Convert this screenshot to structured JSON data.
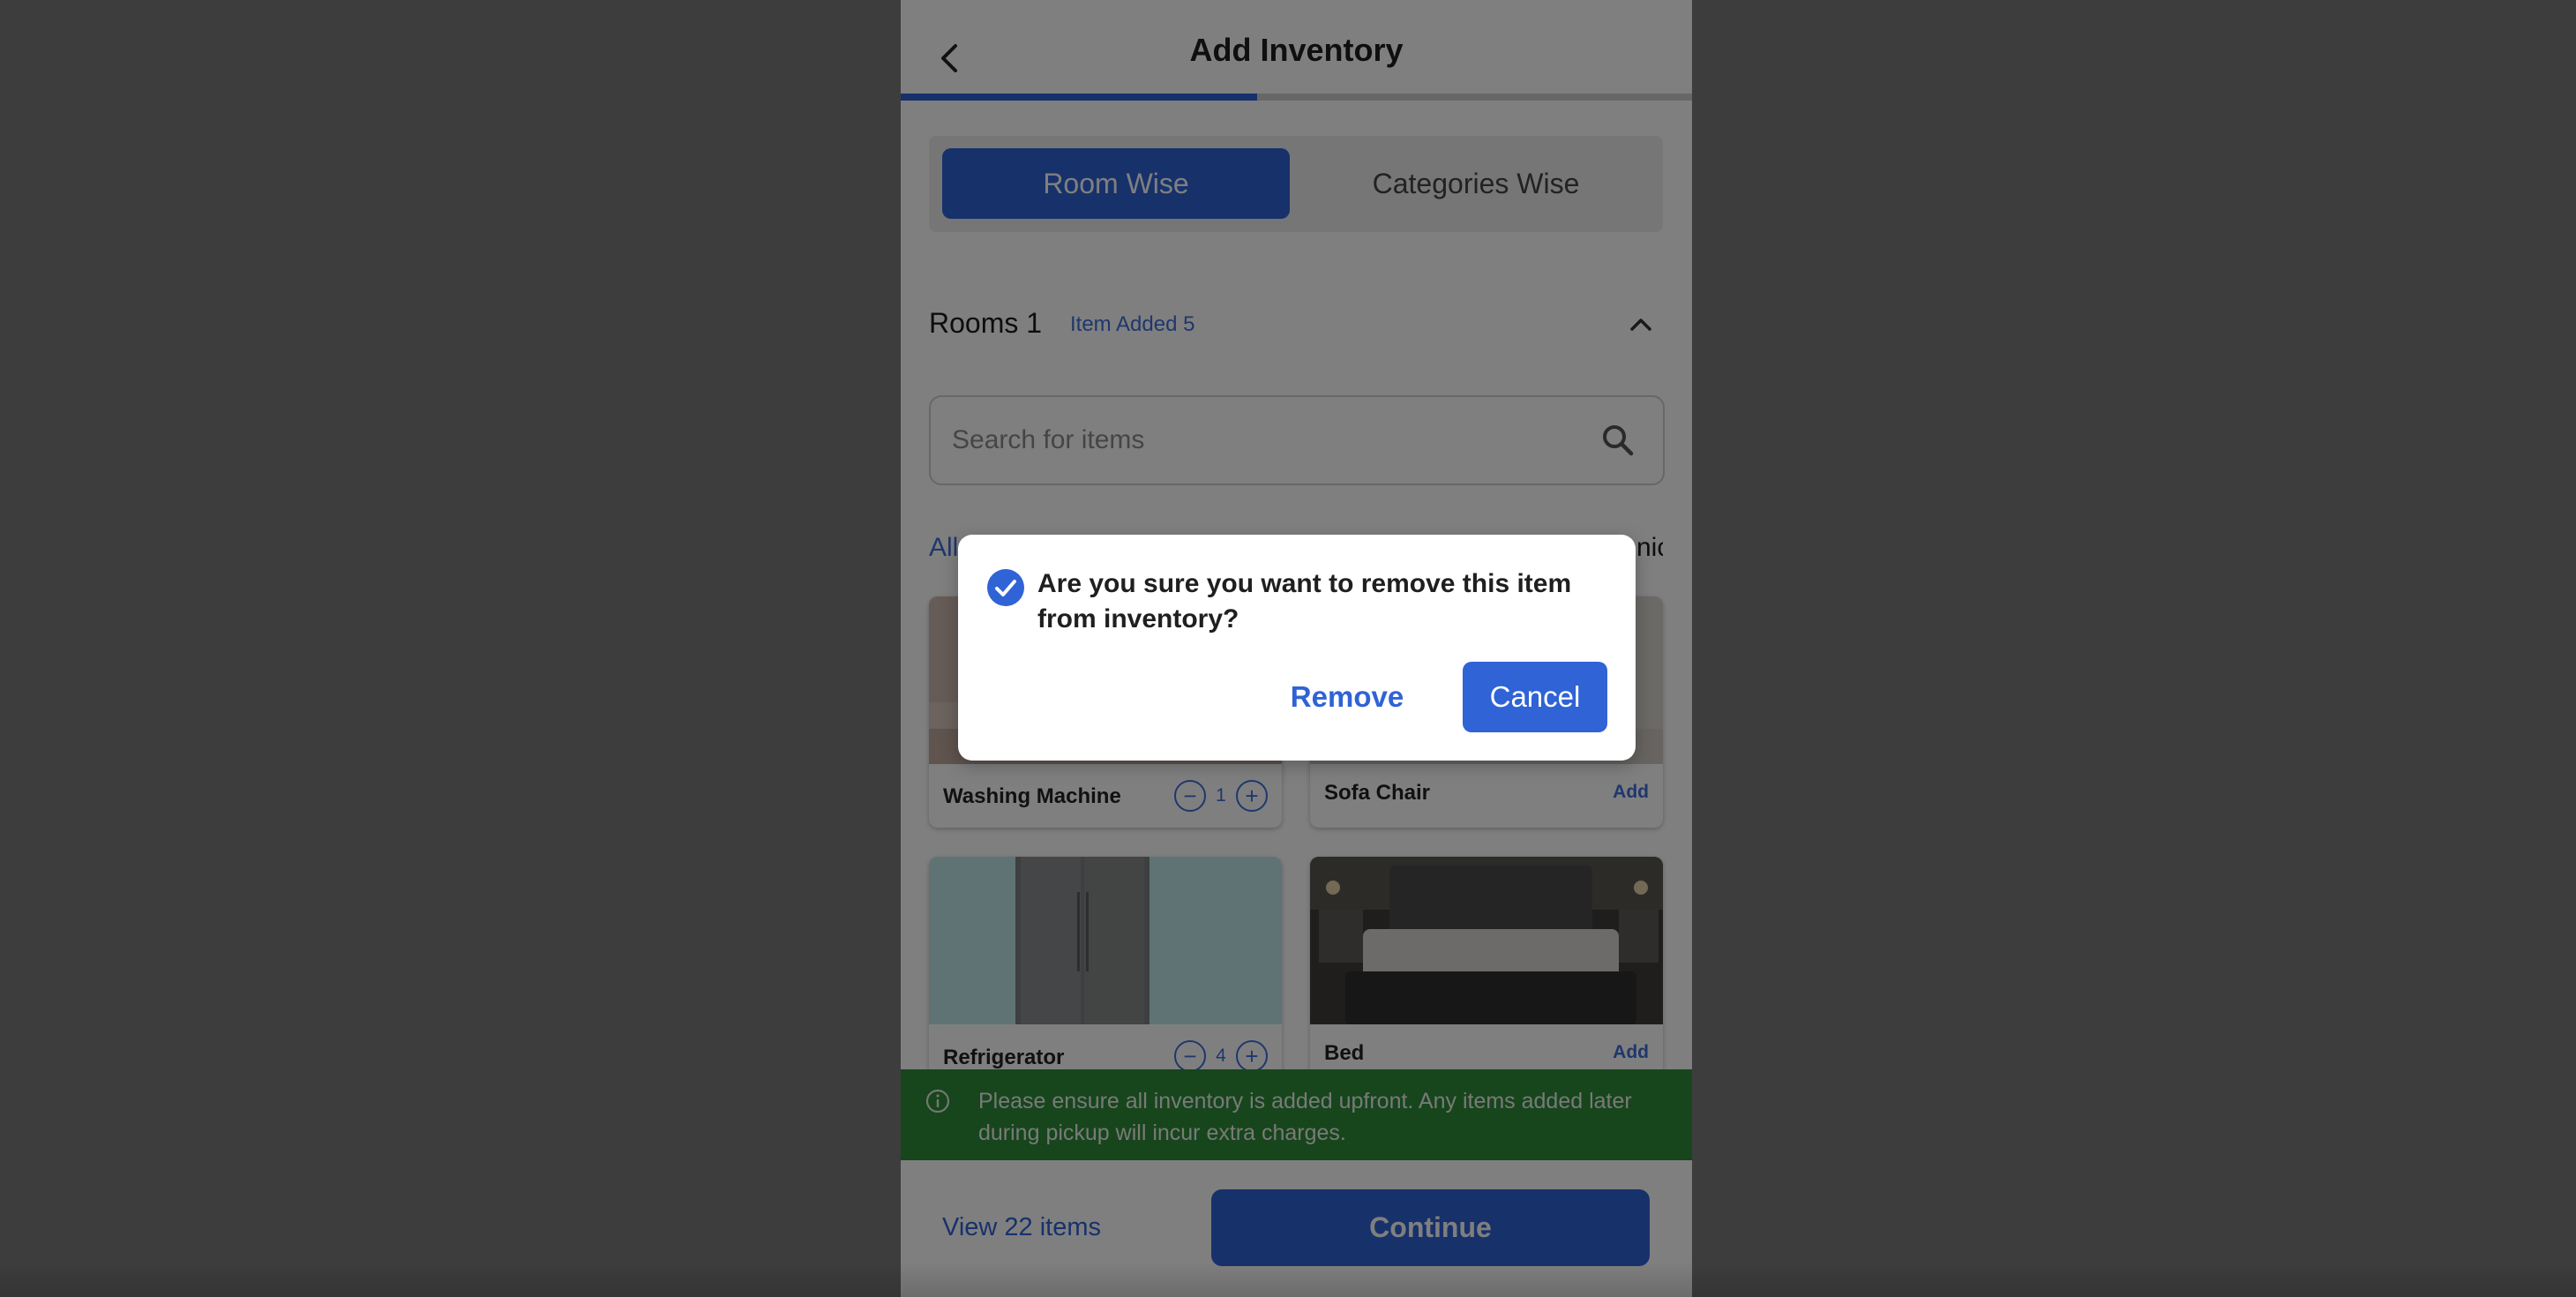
{
  "header": {
    "title": "Add Inventory",
    "progress_fraction": 0.45
  },
  "mode_tabs": [
    {
      "label": "Room Wise",
      "active": true
    },
    {
      "label": "Categories Wise",
      "active": false
    }
  ],
  "room": {
    "title": "Rooms 1",
    "badge": "Item Added 5"
  },
  "search": {
    "placeholder": "Search for items"
  },
  "category_chips": {
    "left_partial": "All",
    "right_partial": "nic"
  },
  "items": [
    {
      "name": "Washing Machine",
      "quantity": "1",
      "action": ""
    },
    {
      "name": "Sofa Chair",
      "quantity": "",
      "action": "Add"
    },
    {
      "name": "Refrigerator",
      "quantity": "4",
      "action": ""
    },
    {
      "name": "Bed",
      "quantity": "",
      "action": "Add"
    }
  ],
  "notice": {
    "text": "Please ensure all inventory is added upfront. Any items added later during pickup will incur extra charges."
  },
  "footer": {
    "view_items": "View 22 items",
    "continue": "Continue"
  },
  "dialog": {
    "message": "Are you sure you want to remove this item from inventory?",
    "remove": "Remove",
    "cancel": "Cancel"
  },
  "colors": {
    "primary": "#2f63d6",
    "notice_bg": "#2f8a39",
    "link": "#3f6fd8"
  }
}
